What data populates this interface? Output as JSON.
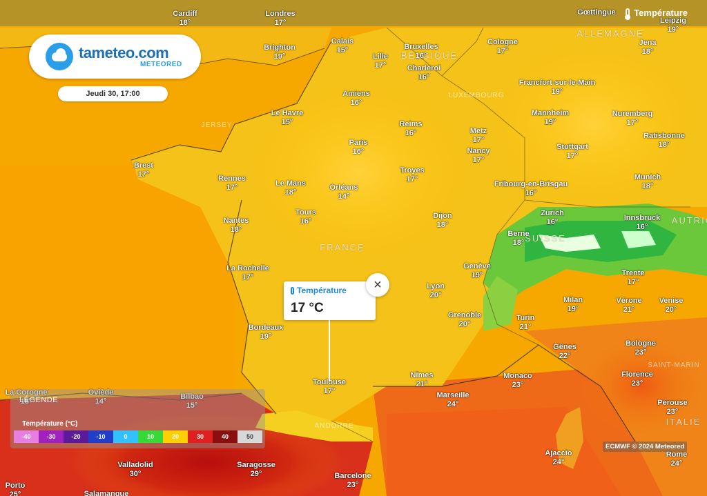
{
  "header": {
    "layer_title": "Température"
  },
  "brand": {
    "name": "tameteo.com",
    "sub": "METEORED"
  },
  "time": {
    "label": "Jeudi 30, 17:00"
  },
  "popup": {
    "title": "Température",
    "value": "17 °C",
    "close_label": "×"
  },
  "legend": {
    "title": "LÉGENDE",
    "subtitle": "Température (°C)",
    "scale": [
      {
        "label": "-40",
        "color": "#e87fe0"
      },
      {
        "label": "-30",
        "color": "#a020c0"
      },
      {
        "label": "-20",
        "color": "#5a1a9a"
      },
      {
        "label": "-10",
        "color": "#1f3fc8"
      },
      {
        "label": "0",
        "color": "#33c0ff"
      },
      {
        "label": "10",
        "color": "#38d838"
      },
      {
        "label": "20",
        "color": "#ffd000"
      },
      {
        "label": "30",
        "color": "#e02020"
      },
      {
        "label": "40",
        "color": "#8a1010"
      },
      {
        "label": "50",
        "color": "#d8d8d8"
      }
    ]
  },
  "credit": "ECMWF © 2024 Meteored",
  "countries": [
    {
      "name": "ALLEMAGNE"
    },
    {
      "name": "BELGIQUE"
    },
    {
      "name": "FRANCE"
    },
    {
      "name": "SUISSE"
    },
    {
      "name": "ITALIE"
    },
    {
      "name": "AUTRICHE"
    },
    {
      "name": "ANDORRE"
    },
    {
      "name": "LUXEMBOURG"
    },
    {
      "name": "JERSEY"
    },
    {
      "name": "SAINT-MARIN"
    }
  ],
  "cities": [
    {
      "name": "Cardiff",
      "temp": "18°"
    },
    {
      "name": "Londres",
      "temp": "17°"
    },
    {
      "name": "Gœttingue",
      "temp": ""
    },
    {
      "name": "Leipzig",
      "temp": "19°"
    },
    {
      "name": "Brighton",
      "temp": "19°"
    },
    {
      "name": "Calais",
      "temp": "15°"
    },
    {
      "name": "Bruxelles",
      "temp": "16°"
    },
    {
      "name": "Cologne",
      "temp": "17°"
    },
    {
      "name": "Jena",
      "temp": "18°"
    },
    {
      "name": "Lille",
      "temp": "17°"
    },
    {
      "name": "Charleroi",
      "temp": "16°"
    },
    {
      "name": "Amiens",
      "temp": "16°"
    },
    {
      "name": "Francfort-sur-le-Main",
      "temp": "19°"
    },
    {
      "name": "Le Havre",
      "temp": "15°"
    },
    {
      "name": "Reims",
      "temp": "16°"
    },
    {
      "name": "Mannheim",
      "temp": "19°"
    },
    {
      "name": "Nuremberg",
      "temp": "17°"
    },
    {
      "name": "Metz",
      "temp": "17°"
    },
    {
      "name": "Ratisbonne",
      "temp": "18°"
    },
    {
      "name": "Paris",
      "temp": "16°"
    },
    {
      "name": "Nancy",
      "temp": "17°"
    },
    {
      "name": "Stuttgart",
      "temp": "17°"
    },
    {
      "name": "Brest",
      "temp": "17°"
    },
    {
      "name": "Troyes",
      "temp": "17°"
    },
    {
      "name": "Rennes",
      "temp": "17°"
    },
    {
      "name": "Le Mans",
      "temp": "18°"
    },
    {
      "name": "Orléans",
      "temp": "14°"
    },
    {
      "name": "Fribourg-en-Brisgau",
      "temp": "16°"
    },
    {
      "name": "Munich",
      "temp": "18°"
    },
    {
      "name": "Tours",
      "temp": "16°"
    },
    {
      "name": "Zurich",
      "temp": "16°"
    },
    {
      "name": "Dijon",
      "temp": "18°"
    },
    {
      "name": "Nantes",
      "temp": "18°"
    },
    {
      "name": "Innsbruck",
      "temp": "16°"
    },
    {
      "name": "Berne",
      "temp": "18°"
    },
    {
      "name": "Genève",
      "temp": "19°"
    },
    {
      "name": "La Rochelle",
      "temp": "17°"
    },
    {
      "name": "Trente",
      "temp": "17°"
    },
    {
      "name": "Lyon",
      "temp": "20°"
    },
    {
      "name": "Milan",
      "temp": "19°"
    },
    {
      "name": "Vérone",
      "temp": "21°"
    },
    {
      "name": "Venise",
      "temp": "20°"
    },
    {
      "name": "Grenoble",
      "temp": "20°"
    },
    {
      "name": "Turin",
      "temp": "21°"
    },
    {
      "name": "Bordeaux",
      "temp": "19°"
    },
    {
      "name": "Gênes",
      "temp": "22°"
    },
    {
      "name": "Bologne",
      "temp": "23°"
    },
    {
      "name": "Nîmes",
      "temp": "21°"
    },
    {
      "name": "Monaco",
      "temp": "23°"
    },
    {
      "name": "Florence",
      "temp": "23°"
    },
    {
      "name": "Toulouse",
      "temp": "17°"
    },
    {
      "name": "Marseille",
      "temp": "24°"
    },
    {
      "name": "La Corogne",
      "temp": "18°"
    },
    {
      "name": "Oviède",
      "temp": "14°"
    },
    {
      "name": "Bilbao",
      "temp": "15°"
    },
    {
      "name": "Pérouse",
      "temp": "23°"
    },
    {
      "name": "Ajaccio",
      "temp": "24°"
    },
    {
      "name": "Rome",
      "temp": "24°"
    },
    {
      "name": "Valladolid",
      "temp": "30°"
    },
    {
      "name": "Saragosse",
      "temp": "29°"
    },
    {
      "name": "Barcelone",
      "temp": "23°"
    },
    {
      "name": "Porto",
      "temp": "25°"
    },
    {
      "name": "Salamanque",
      "temp": ""
    }
  ]
}
